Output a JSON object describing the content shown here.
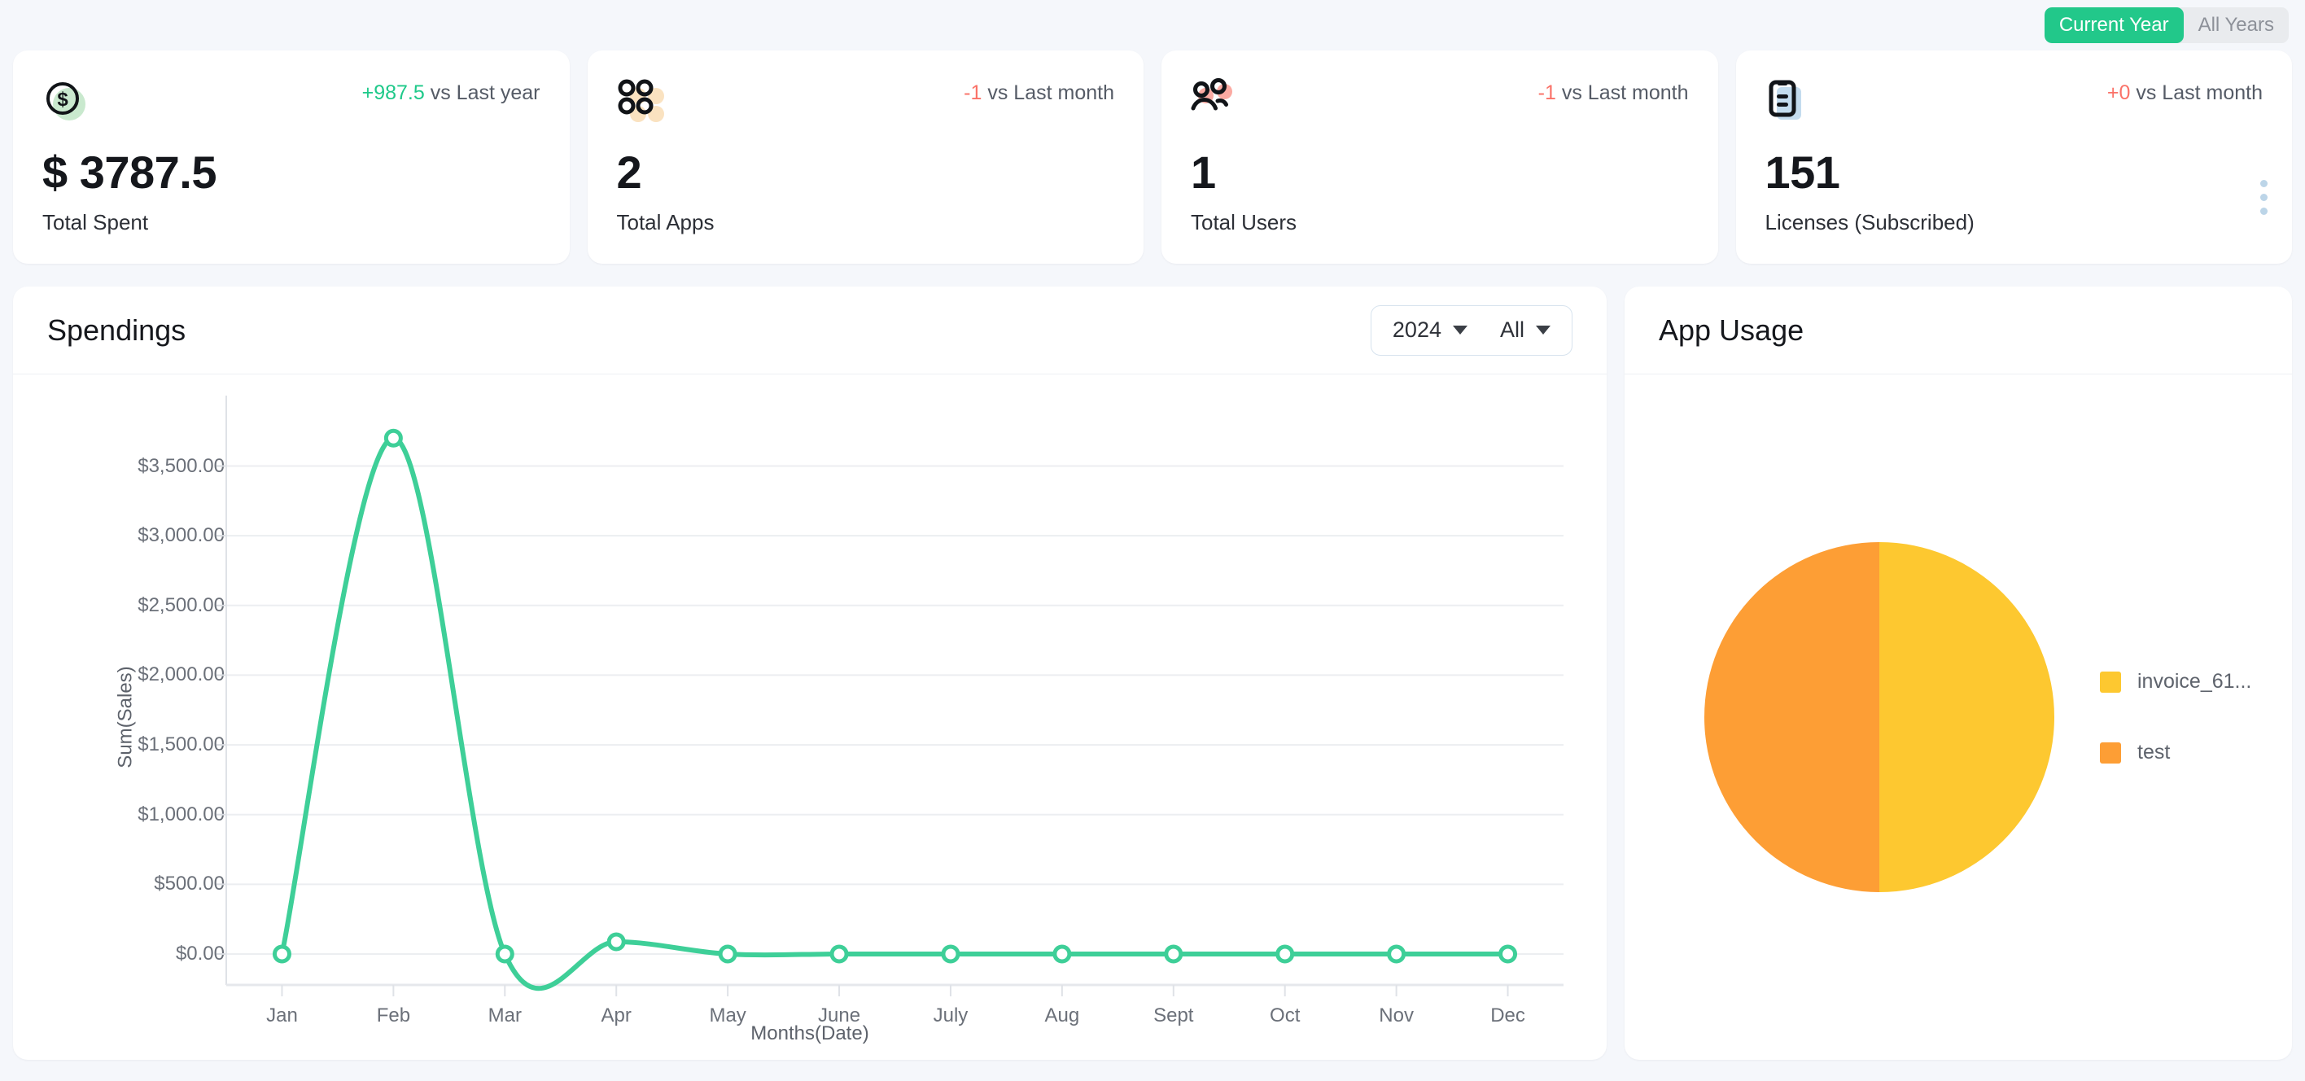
{
  "header": {
    "range_toggle": {
      "options": [
        {
          "label": "Current Year",
          "active": true
        },
        {
          "label": "All Years",
          "active": false
        }
      ]
    }
  },
  "stats": [
    {
      "icon": "dollar-coin-icon",
      "delta_value": "+987.5",
      "delta_suffix": "vs Last year",
      "delta_direction": "up",
      "value": "$ 3787.5",
      "label": "Total Spent"
    },
    {
      "icon": "apps-grid-icon",
      "delta_value": "-1",
      "delta_suffix": "vs Last month",
      "delta_direction": "down",
      "value": "2",
      "label": "Total Apps"
    },
    {
      "icon": "users-icon",
      "delta_value": "-1",
      "delta_suffix": "vs Last month",
      "delta_direction": "down",
      "value": "1",
      "label": "Total Users"
    },
    {
      "icon": "license-document-icon",
      "delta_value": "+0",
      "delta_suffix": "vs Last month",
      "delta_direction": "down",
      "value": "151",
      "label": "Licenses (Subscribed)",
      "menu": "more-options-icon"
    }
  ],
  "spendings": {
    "title": "Spendings",
    "year_select": {
      "value": "2024"
    },
    "scope_select": {
      "value": "All"
    }
  },
  "app_usage": {
    "title": "App Usage"
  },
  "colors": {
    "accent_green": "#22c88a",
    "line_green": "#3ecf98",
    "negative_red": "#fa7268",
    "positive_green": "#1fc98a",
    "pie_yellow": "#fdc830",
    "pie_orange": "#fd9e35",
    "page_bg": "#f5f7fb"
  },
  "chart_data": [
    {
      "type": "line",
      "title": "Spendings",
      "xlabel": "Months(Date)",
      "ylabel": "Sum(Sales)",
      "categories": [
        "Jan",
        "Feb",
        "Mar",
        "Apr",
        "May",
        "June",
        "July",
        "Aug",
        "Sept",
        "Oct",
        "Nov",
        "Dec"
      ],
      "values": [
        0,
        3700,
        0,
        87.5,
        0,
        0,
        0,
        0,
        0,
        0,
        0,
        0
      ],
      "ytick_labels": [
        "$0.00",
        "$500.00",
        "$1,000.00",
        "$1,500.00",
        "$2,000.00",
        "$2,500.00",
        "$3,000.00",
        "$3,500.00"
      ],
      "ytick_values": [
        0,
        500,
        1000,
        1500,
        2000,
        2500,
        3000,
        3500
      ],
      "ylim": [
        0,
        3900
      ],
      "grid": true,
      "legend": "none",
      "series_color": "#3ecf98",
      "marker": "open-circle",
      "curve": "spline"
    },
    {
      "type": "pie",
      "title": "App Usage",
      "labels": [
        "invoice_61...",
        "test"
      ],
      "values": [
        50,
        50
      ],
      "colors": [
        "#fdc830",
        "#fd9e35"
      ],
      "legend": "right"
    }
  ]
}
